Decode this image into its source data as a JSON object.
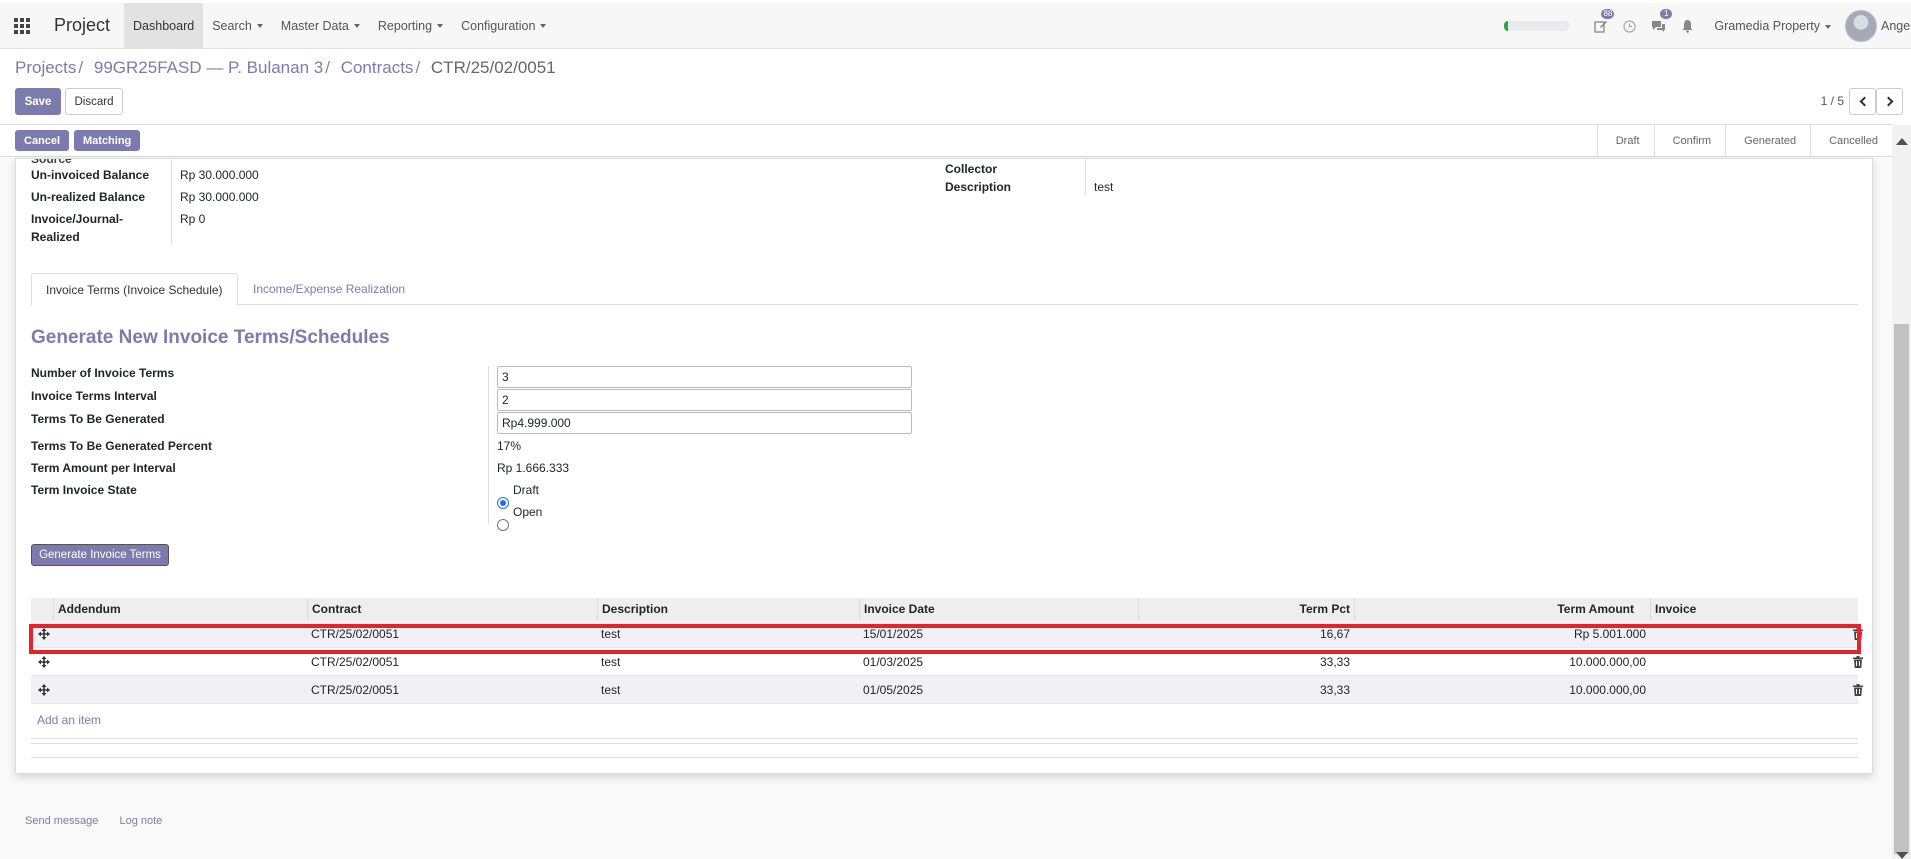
{
  "topbar": {
    "app_title": "Project",
    "nav": [
      {
        "label": "Dashboard",
        "active": true,
        "dropdown": false
      },
      {
        "label": "Search",
        "dropdown": true
      },
      {
        "label": "Master Data",
        "dropdown": true
      },
      {
        "label": "Reporting",
        "dropdown": true
      },
      {
        "label": "Configuration",
        "dropdown": true
      }
    ],
    "progress_fraction": 0.06,
    "activity_badge": "88",
    "messages_badge": "1",
    "company": "Gramedia Property",
    "user": "Angel"
  },
  "breadcrumb": {
    "items": [
      "Projects",
      "99GR25FASD — P. Bulanan 3",
      "Contracts"
    ],
    "current": "CTR/25/02/0051"
  },
  "actions": {
    "save": "Save",
    "discard": "Discard"
  },
  "pager": {
    "text": "1 / 5"
  },
  "statusbar": {
    "cancel": "Cancel",
    "matching": "Matching",
    "stages": [
      "Draft",
      "Confirm",
      "Generated",
      "Cancelled"
    ]
  },
  "form": {
    "source_label": "Source",
    "uninvoiced_label": "Un-invoiced Balance",
    "uninvoiced_value": "Rp 30.000.000",
    "unrealized_label": "Un-realized Balance",
    "unrealized_value": "Rp 30.000.000",
    "invoice_journal_label_1": "Invoice/Journal-",
    "invoice_journal_label_2": "Realized",
    "invoice_journal_value": "Rp 0",
    "collector_label": "Collector",
    "description_label": "Description",
    "description_value": "test"
  },
  "tabs": [
    {
      "label": "Invoice Terms (Invoice Schedule)",
      "active": true
    },
    {
      "label": "Income/Expense Realization",
      "active": false
    }
  ],
  "generate": {
    "title": "Generate New Invoice Terms/Schedules",
    "num_terms_label": "Number of Invoice Terms",
    "num_terms_value": "3",
    "interval_label": "Invoice Terms Interval",
    "interval_value": "2",
    "to_generate_label": "Terms To Be Generated",
    "to_generate_value": "Rp4.999.000",
    "percent_label": "Terms To Be Generated Percent",
    "percent_value": "17%",
    "amount_label": "Term Amount per Interval",
    "amount_value": "Rp 1.666.333",
    "state_label": "Term Invoice State",
    "state_options": [
      "Draft",
      "Open"
    ],
    "state_selected": "Draft",
    "button": "Generate Invoice Terms"
  },
  "table": {
    "columns": [
      "Addendum",
      "Contract",
      "Description",
      "Invoice Date",
      "Term Pct",
      "Term Amount",
      "Invoice"
    ],
    "rows": [
      {
        "addendum": "",
        "contract": "CTR/25/02/0051",
        "description": "test",
        "invoice_date": "15/01/2025",
        "term_pct": "16,67",
        "term_amount": "Rp 5.001.000",
        "invoice": ""
      },
      {
        "addendum": "",
        "contract": "CTR/25/02/0051",
        "description": "test",
        "invoice_date": "01/03/2025",
        "term_pct": "33,33",
        "term_amount": "10.000.000,00",
        "invoice": ""
      },
      {
        "addendum": "",
        "contract": "CTR/25/02/0051",
        "description": "test",
        "invoice_date": "01/05/2025",
        "term_pct": "33,33",
        "term_amount": "10.000.000,00",
        "invoice": ""
      }
    ],
    "add_item": "Add an item"
  },
  "chatter": {
    "send_message": "Send message",
    "log_note": "Log note"
  },
  "colors": {
    "brand": "#7c7bad",
    "highlight": "#e4232b",
    "progress": "#28a745"
  }
}
